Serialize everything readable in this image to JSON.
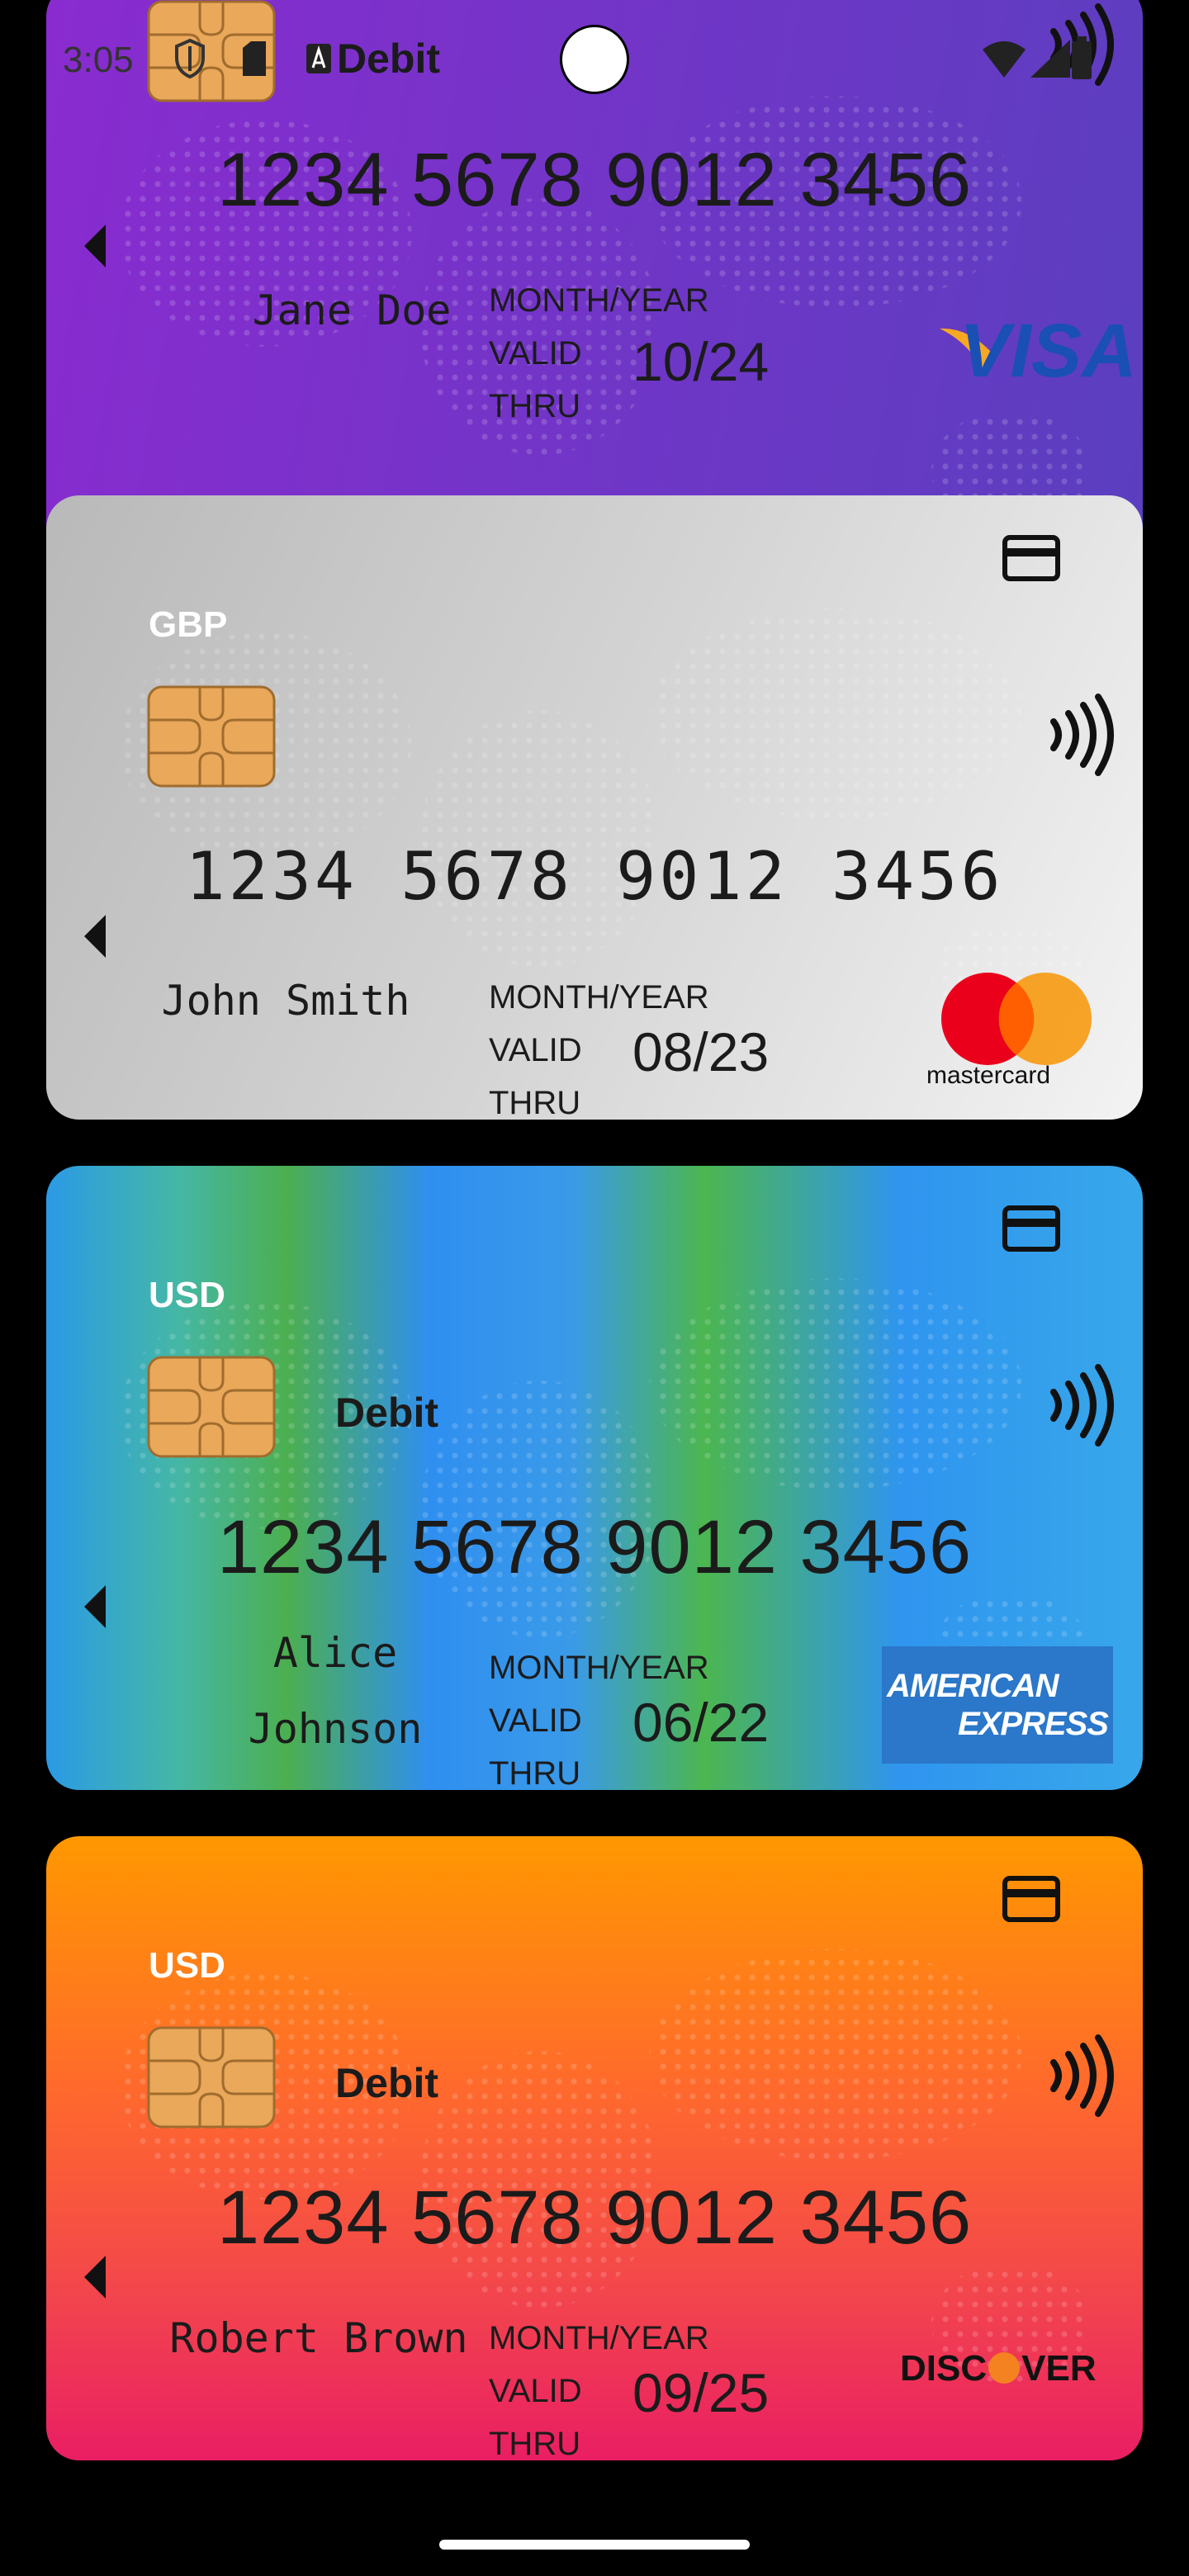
{
  "status_bar": {
    "time": "3:05",
    "notification_label": "Debit"
  },
  "cards": [
    {
      "brand": "VISA",
      "number": "1234 5678 9012 3456",
      "holder_line1": "Jane Doe",
      "holder_line2": "",
      "valid_header": "MONTH/YEAR",
      "valid_line1": "VALID",
      "valid_line2": "THRU",
      "expiry": "10/24"
    },
    {
      "currency": "GBP",
      "brand": "mastercard",
      "number": "1234 5678 9012 3456",
      "holder_line1": "John Smith",
      "valid_header": "MONTH/YEAR",
      "valid_line1": "VALID",
      "valid_line2": "THRU",
      "expiry": "08/23"
    },
    {
      "currency": "USD",
      "type_label": "Debit",
      "brand_line1": "AMERICAN",
      "brand_line2": "EXPRESS",
      "number": "1234 5678 9012 3456",
      "holder_line1": "Alice",
      "holder_line2": "Johnson",
      "valid_header": "MONTH/YEAR",
      "valid_line1": "VALID",
      "valid_line2": "THRU",
      "expiry": "06/22"
    },
    {
      "currency": "USD",
      "type_label": "Debit",
      "brand_part1": "DISC",
      "brand_part2": "VER",
      "number": "1234 5678 9012 3456",
      "holder_line1": "Robert Brown",
      "valid_header": "MONTH/YEAR",
      "valid_line1": "VALID",
      "valid_line2": "THRU",
      "expiry": "09/25"
    }
  ],
  "icons": {
    "chip": "chip-icon",
    "contactless": "contactless-icon",
    "card_type": "credit-card-icon",
    "scroll_left": "chevron-left-icon"
  },
  "colors": {
    "visa_blue": "#1a4fb4",
    "visa_gold": "#f7a823",
    "mastercard_red": "#eb001b",
    "mastercard_orange": "#f79e1b",
    "amex_blue": "#2b77c9",
    "discover_orange": "#f58220",
    "chip_gold": "#e9a85a"
  }
}
